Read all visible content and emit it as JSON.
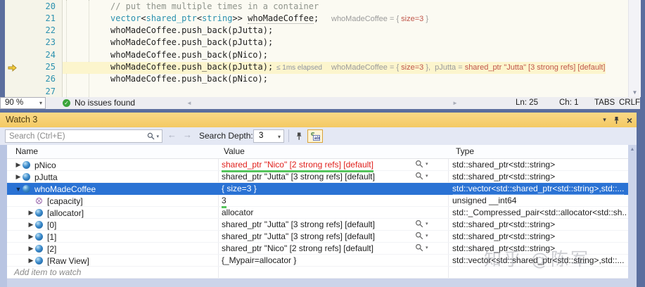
{
  "icons": {
    "dropdown": "▾",
    "back": "←",
    "forward": "→",
    "up_scroll": "▲",
    "down_scroll": "▼",
    "left_scroll": "◄",
    "right_scroll": "►",
    "check": "✓",
    "close": "×",
    "collapsed": "▶",
    "expanded": "▼"
  },
  "colors": {
    "selection_blue": "#2a72d4",
    "changed_value_red": "#e0201c",
    "annotation_green": "#55c45c",
    "title_orange": "#f3c963",
    "frame_blue": "#5b6e9e",
    "identifier_teal": "#2b91af"
  },
  "editor": {
    "zoom_level": "90 %",
    "health": "No issues found",
    "status": {
      "ln": "Ln: 25",
      "ch": "Ch: 1",
      "tabs": "TABS",
      "eol": "CRLF"
    },
    "lines": [
      {
        "num": "20",
        "segments": [
          {
            "t": "// put them multiple times in a container",
            "c": "comment"
          }
        ]
      },
      {
        "num": "21",
        "segments": [
          {
            "t": "vector",
            "c": "type"
          },
          {
            "t": "<",
            "c": "plain"
          },
          {
            "t": "shared_ptr",
            "c": "type"
          },
          {
            "t": "<",
            "c": "plain"
          },
          {
            "t": "string",
            "c": "type"
          },
          {
            "t": ">> ",
            "c": "plain"
          },
          {
            "t": "whoMadeCoffee",
            "c": "plain dotted"
          },
          {
            "t": ";",
            "c": "plain"
          }
        ],
        "annotation": [
          {
            "t": "whoMadeCoffee = { ",
            "c": "label"
          },
          {
            "t": "size=3",
            "c": "value"
          },
          {
            "t": " }",
            "c": "label"
          }
        ]
      },
      {
        "num": "22",
        "segments": [
          {
            "t": "whoMadeCoffee.push_back(pJutta);",
            "c": "plain"
          }
        ]
      },
      {
        "num": "23",
        "segments": [
          {
            "t": "whoMadeCoffee.push_back(pJutta);",
            "c": "plain"
          }
        ]
      },
      {
        "num": "24",
        "segments": [
          {
            "t": "whoMadeCoffee.push_back(pNico);",
            "c": "plain"
          }
        ]
      },
      {
        "num": "25",
        "current": true,
        "segments": [
          {
            "t": "whoMadeCoffee.push_back(pJutta);",
            "c": "plain"
          }
        ],
        "perf": "≤ 1ms elapsed",
        "annotation": [
          {
            "t": "whoMadeCoffee = { ",
            "c": "label"
          },
          {
            "t": "size=3",
            "c": "value"
          },
          {
            "t": " },  pJutta = ",
            "c": "label"
          },
          {
            "t": "shared_ptr \"Jutta\" [3 strong refs] [default]",
            "c": "value"
          }
        ]
      },
      {
        "num": "26",
        "segments": [
          {
            "t": "whoMadeCoffee.push_back(pNico);",
            "c": "plain"
          }
        ]
      },
      {
        "num": "27",
        "segments": []
      }
    ]
  },
  "watch": {
    "title": "Watch 3",
    "search_placeholder": "Search (Ctrl+E)",
    "search_depth_label": "Search Depth:",
    "search_depth_value": "3",
    "columns": [
      "Name",
      "Value",
      "Type"
    ],
    "add_item_label": "Add item to watch",
    "rows": [
      {
        "level": 0,
        "expander": "collapsed",
        "icon": "sphere",
        "name": "pNico",
        "value": "shared_ptr \"Nico\" [2 strong refs] [default]",
        "value_changed": true,
        "value_underlined": true,
        "magnifier": true,
        "type": "std::shared_ptr<std::string>"
      },
      {
        "level": 0,
        "expander": "collapsed",
        "icon": "sphere",
        "name": "pJutta",
        "value": "shared_ptr \"Jutta\" [3 strong refs] [default]",
        "magnifier": true,
        "type": "std::shared_ptr<std::string>"
      },
      {
        "level": 0,
        "expander": "expanded",
        "icon": "sphere",
        "name": "whoMadeCoffee",
        "value": "{ size=3 }",
        "selected": true,
        "type": "std::vector<std::shared_ptr<std::string>,std::..."
      },
      {
        "level": 1,
        "expander": "none",
        "icon": "member",
        "name": "[capacity]",
        "value": "3",
        "value_underlined": true,
        "type": "unsigned __int64"
      },
      {
        "level": 1,
        "expander": "collapsed",
        "icon": "sphere",
        "name": "[allocator]",
        "value": "allocator",
        "type": "std::_Compressed_pair<std::allocator<std::sh..."
      },
      {
        "level": 1,
        "expander": "collapsed",
        "icon": "sphere",
        "name": "[0]",
        "value": "shared_ptr \"Jutta\" [3 strong refs] [default]",
        "magnifier": true,
        "type": "std::shared_ptr<std::string>"
      },
      {
        "level": 1,
        "expander": "collapsed",
        "icon": "sphere",
        "name": "[1]",
        "value": "shared_ptr \"Jutta\" [3 strong refs] [default]",
        "magnifier": true,
        "type": "std::shared_ptr<std::string>"
      },
      {
        "level": 1,
        "expander": "collapsed",
        "icon": "sphere",
        "name": "[2]",
        "value": "shared_ptr \"Nico\" [2 strong refs] [default]",
        "magnifier": true,
        "type": "std::shared_ptr<std::string>"
      },
      {
        "level": 1,
        "expander": "collapsed",
        "icon": "sphere",
        "name": "[Raw View]",
        "value": "{_Mypair=allocator }",
        "type": "std::vector<std::shared_ptr<std::string>,std::..."
      }
    ]
  },
  "watermark": "知乎 @陈军"
}
